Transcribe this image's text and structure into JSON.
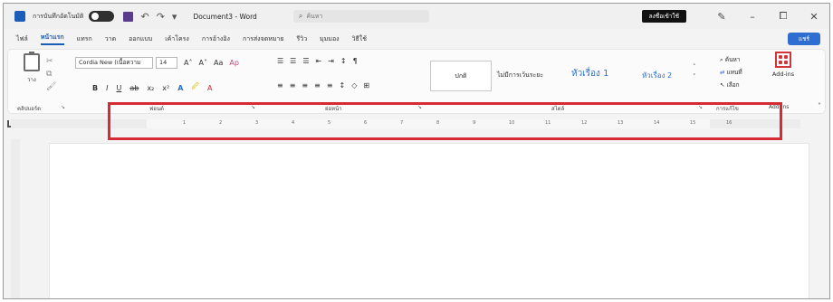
{
  "titlebar": {
    "autosave_label": "การบันทึกอัตโนมัติ",
    "undo": "↶",
    "redo": "↷",
    "doc_title": "Document3 - Word",
    "search_placeholder": "ค้นหา",
    "account": "ลงชื่อเข้าใช้",
    "pen_icon": "✎",
    "minimize": "–",
    "maximize": "⧠",
    "close": "✕"
  },
  "tabs": [
    "ไฟล์",
    "หน้าแรก",
    "แทรก",
    "วาด",
    "ออกแบบ",
    "เค้าโครง",
    "การอ้างอิง",
    "การส่งจดหมาย",
    "รีวิว",
    "มุมมอง",
    "วิธีใช้"
  ],
  "active_tab": "หน้าแรก",
  "share_label": "แชร์",
  "clipboard": {
    "paste_label": "วาง"
  },
  "font": {
    "name": "Cordia New (เนื้อความ",
    "size": "14",
    "grow": "A˄",
    "shrink": "A˅",
    "case": "Aa",
    "clear": "Ap",
    "bold": "B",
    "italic": "I",
    "underline": "U",
    "strike": "ab",
    "subscript": "x₂",
    "superscript": "x²",
    "effects": "A",
    "highlight": "🖉",
    "color": "A"
  },
  "paragraph": {
    "bullets": "☰",
    "numbering": "☰",
    "multilevel": "☰",
    "decrease_indent": "⇤",
    "increase_indent": "⇥",
    "sort": "↕",
    "marks": "¶",
    "align_left": "≡",
    "center": "≡",
    "align_right": "≡",
    "justify": "≡",
    "distributed": "≡",
    "spacing": "↕",
    "shading": "◇",
    "borders": "⊞"
  },
  "styles": {
    "normal": "ปกติ",
    "no_spacing": "ไม่มีการเว้นระยะ",
    "heading1": "หัวเรื่อง 1",
    "heading2": "หัวเรื่อง 2"
  },
  "editing": {
    "find": "ค้นหา",
    "replace": "แทนที่",
    "select": "เลือก"
  },
  "addins_label": "Add-ins",
  "group_labels": {
    "clipboard": "คลิปบอร์ด",
    "font": "ฟอนต์",
    "paragraph": "ย่อหน้า",
    "styles": "สไตล์",
    "editing": "การแก้ไข",
    "addins": "Add-ins"
  },
  "ruler_ticks": [
    "1",
    "2",
    "3",
    "4",
    "5",
    "6",
    "7",
    "8",
    "9",
    "10",
    "11",
    "12",
    "13",
    "14",
    "15",
    "16"
  ],
  "colors": {
    "accent": "#1b5db8",
    "highlight_border": "#d62a35",
    "heading_style": "#2f6ed1"
  }
}
